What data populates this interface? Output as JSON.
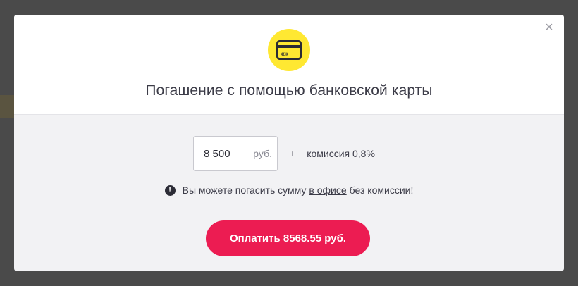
{
  "modal": {
    "close_symbol": "×",
    "icon": "bank-card-icon",
    "card_icon_text": "ЖЖ",
    "title": "Погашение с помощью банковской карты",
    "amount": {
      "value": "8 500",
      "currency": "руб."
    },
    "plus": "+",
    "commission": "комиссия 0,8%",
    "note": {
      "icon_symbol": "!",
      "text_before": "Вы можете погасить сумму",
      "link": "в офисе",
      "text_after": "без комиссии!"
    },
    "pay_button": "Оплатить 8568.55 руб.",
    "colors": {
      "accent": "#ec1c52",
      "badge": "#ffe832"
    }
  }
}
